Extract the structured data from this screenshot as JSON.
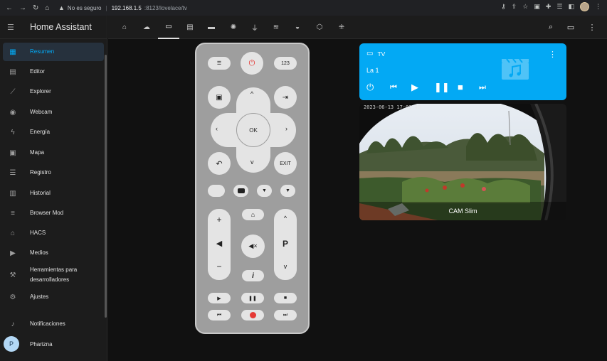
{
  "browser": {
    "security_label": "No es seguro",
    "host": "192.168.1.5",
    "path": ":8123/lovelace/tv"
  },
  "sidebar": {
    "title": "Home Assistant",
    "items": [
      {
        "label": "Resumen",
        "icon": "dashboard-icon",
        "active": true
      },
      {
        "label": "Editor",
        "icon": "file-icon"
      },
      {
        "label": "Explorer",
        "icon": "chart-icon"
      },
      {
        "label": "Webcam",
        "icon": "webcam-icon"
      },
      {
        "label": "Energía",
        "icon": "lightning-icon"
      },
      {
        "label": "Mapa",
        "icon": "map-icon"
      },
      {
        "label": "Registro",
        "icon": "list-icon"
      },
      {
        "label": "Historial",
        "icon": "history-chart-icon"
      },
      {
        "label": "Browser Mod",
        "icon": "server-icon"
      },
      {
        "label": "HACS",
        "icon": "store-icon"
      },
      {
        "label": "Medios",
        "icon": "play-box-icon"
      },
      {
        "label_line1": "Herramientas para",
        "label_line2": "desarrolladores",
        "icon": "hammer-icon"
      },
      {
        "label": "Ajustes",
        "icon": "gear-icon"
      }
    ],
    "notifications_label": "Notificaciones",
    "user": {
      "initial": "P",
      "name": "Pharizna"
    }
  },
  "toolbar": {
    "tabs": [
      {
        "icon": "home-icon"
      },
      {
        "icon": "cloud-icon"
      },
      {
        "icon": "tv-icon",
        "active": true
      },
      {
        "icon": "projector-icon"
      },
      {
        "icon": "receiver-icon"
      },
      {
        "icon": "alarm-light-icon"
      },
      {
        "icon": "plug-icon"
      },
      {
        "icon": "pool-icon"
      },
      {
        "icon": "docker-icon"
      },
      {
        "icon": "hexagon-icon"
      },
      {
        "icon": "network-icon"
      }
    ]
  },
  "remote": {
    "power": "⏻",
    "num": "123",
    "ok": "OK",
    "exit": "EXIT",
    "channel": "P",
    "info": "i"
  },
  "media_player": {
    "name": "TV",
    "channel": "La 1",
    "accent": "#03a9f4"
  },
  "camera": {
    "timestamp": "2023-06-13 17:01:48",
    "caption": "CAM Slim"
  }
}
